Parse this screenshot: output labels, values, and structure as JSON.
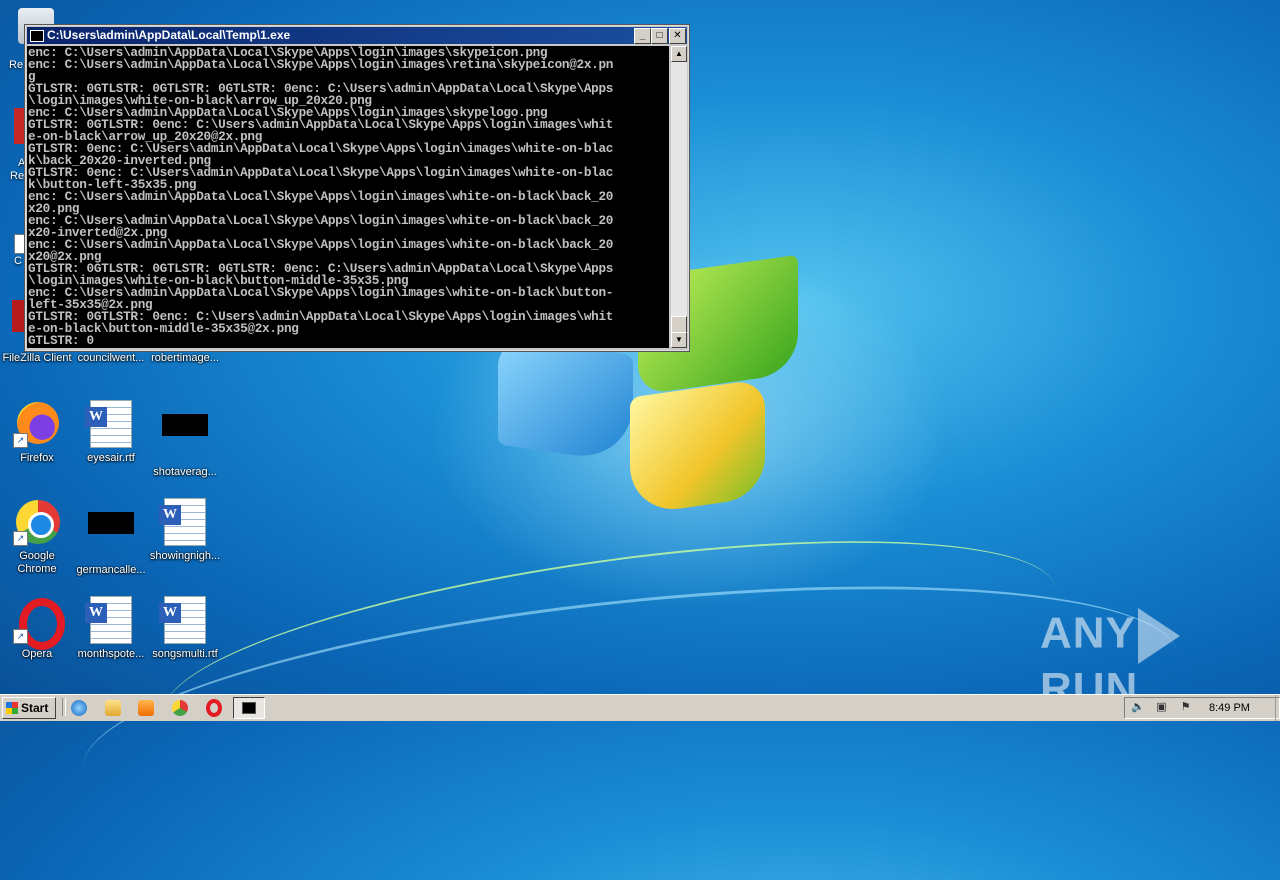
{
  "console": {
    "title": "C:\\Users\\admin\\AppData\\Local\\Temp\\1.exe",
    "output": "enc: C:\\Users\\admin\\AppData\\Local\\Skype\\Apps\\login\\images\\skypeicon.png\nenc: C:\\Users\\admin\\AppData\\Local\\Skype\\Apps\\login\\images\\retina\\skypeicon@2x.pn\ng\nGTLSTR: 0GTLSTR: 0GTLSTR: 0GTLSTR: 0enc: C:\\Users\\admin\\AppData\\Local\\Skype\\Apps\n\\login\\images\\white-on-black\\arrow_up_20x20.png\nenc: C:\\Users\\admin\\AppData\\Local\\Skype\\Apps\\login\\images\\skypelogo.png\nGTLSTR: 0GTLSTR: 0enc: C:\\Users\\admin\\AppData\\Local\\Skype\\Apps\\login\\images\\whit\ne-on-black\\arrow_up_20x20@2x.png\nGTLSTR: 0enc: C:\\Users\\admin\\AppData\\Local\\Skype\\Apps\\login\\images\\white-on-blac\nk\\back_20x20-inverted.png\nGTLSTR: 0enc: C:\\Users\\admin\\AppData\\Local\\Skype\\Apps\\login\\images\\white-on-blac\nk\\button-left-35x35.png\nenc: C:\\Users\\admin\\AppData\\Local\\Skype\\Apps\\login\\images\\white-on-black\\back_20\nx20.png\nenc: C:\\Users\\admin\\AppData\\Local\\Skype\\Apps\\login\\images\\white-on-black\\back_20\nx20-inverted@2x.png\nenc: C:\\Users\\admin\\AppData\\Local\\Skype\\Apps\\login\\images\\white-on-black\\back_20\nx20@2x.png\nGTLSTR: 0GTLSTR: 0GTLSTR: 0GTLSTR: 0enc: C:\\Users\\admin\\AppData\\Local\\Skype\\Apps\n\\login\\images\\white-on-black\\button-middle-35x35.png\nenc: C:\\Users\\admin\\AppData\\Local\\Skype\\Apps\\login\\images\\white-on-black\\button-\nleft-35x35@2x.png\nGTLSTR: 0GTLSTR: 0enc: C:\\Users\\admin\\AppData\\Local\\Skype\\Apps\\login\\images\\whit\ne-on-black\\button-middle-35x35@2x.png\nGTLSTR: 0",
    "buttons": {
      "minimize": "_",
      "maximize": "□",
      "close": "✕"
    }
  },
  "desktop": {
    "icons": [
      {
        "label": "FileZilla Client",
        "type": "filezilla"
      },
      {
        "label": "councilwent...",
        "type": "hidden"
      },
      {
        "label": "robertimage...",
        "type": "hidden"
      },
      {
        "label": "Firefox",
        "type": "firefox"
      },
      {
        "label": "eyesair.rtf",
        "type": "word"
      },
      {
        "label": "shotaverag...",
        "type": "blackbox"
      },
      {
        "label": "Google Chrome",
        "type": "chrome"
      },
      {
        "label": "germancalle...",
        "type": "blackbox"
      },
      {
        "label": "showingnigh...",
        "type": "word"
      },
      {
        "label": "Opera",
        "type": "opera"
      },
      {
        "label": "monthspote...",
        "type": "word"
      },
      {
        "label": "songsmulti.rtf",
        "type": "word"
      }
    ],
    "partial_labels": [
      "Re",
      "A",
      "Re",
      "C"
    ]
  },
  "taskbar": {
    "start_label": "Start",
    "clock": "8:49 PM",
    "quick_launch": [
      "ie-icon",
      "explorer-icon",
      "media-player-icon",
      "chrome-icon",
      "opera-icon"
    ]
  },
  "watermark": {
    "left": "ANY",
    "right": "RUN"
  },
  "colors": {
    "titlebar": "#0a246a",
    "console_bg": "#000000",
    "console_text": "#c0c0c0"
  }
}
